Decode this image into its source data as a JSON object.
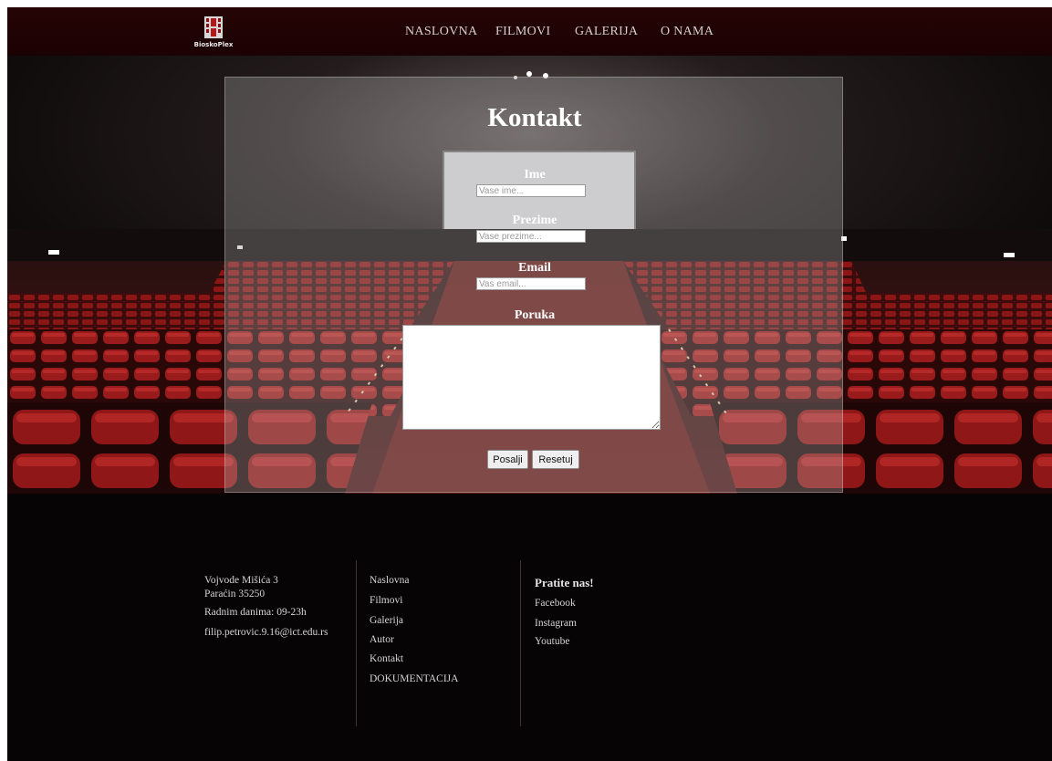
{
  "header": {
    "logo_text": "BioskoPlex",
    "nav": [
      "NASLOVNA",
      "FILMOVI",
      "GALERIJA",
      "O NAMA"
    ]
  },
  "contact_form": {
    "title": "Kontakt",
    "fields": [
      {
        "label": "Ime",
        "placeholder": "Vase ime..."
      },
      {
        "label": "Prezime",
        "placeholder": "Vase prezime..."
      },
      {
        "label": "Email",
        "placeholder": "Vas email..."
      }
    ],
    "message_label": "Poruka",
    "submit_label": "Posalji",
    "reset_label": "Resetuj"
  },
  "footer": {
    "address_line1": "Vojvode Mišića 3",
    "address_line2": "Paraćin 35250",
    "hours": "Radnim danima: 09-23h",
    "email": "filip.petrovic.9.16@ict.edu.rs",
    "links": [
      "Naslovna",
      "Filmovi",
      "Galerija",
      "Autor",
      "Kontakt",
      "DOKUMENTACIJA"
    ],
    "social_heading": "Pratite nas!",
    "social": [
      "Facebook",
      "Instagram",
      "Youtube"
    ]
  },
  "colors": {
    "navbar": "#210304",
    "background": "#070405",
    "seat_red": "#8a1414",
    "panel_overlay": "rgba(200,200,200,0.28)"
  }
}
